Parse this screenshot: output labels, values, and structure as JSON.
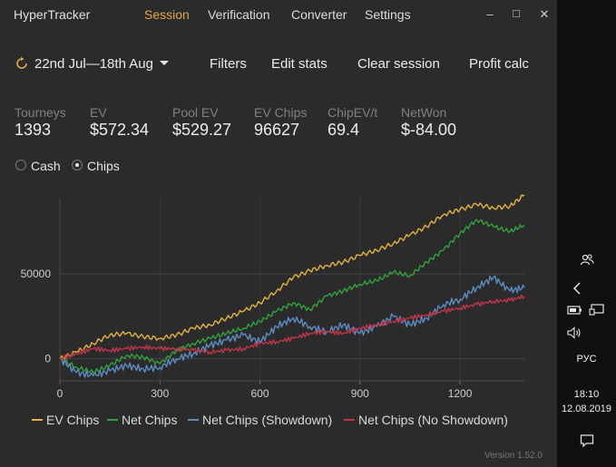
{
  "app": {
    "title": "HyperTracker",
    "nav": [
      "Session",
      "Verification",
      "Converter",
      "Settings"
    ],
    "active_nav": "Session"
  },
  "toolbar": {
    "date_range": "22nd Jul—18th Aug",
    "filters": "Filters",
    "edit_stats": "Edit stats",
    "clear_session": "Clear session",
    "profit_calc": "Profit calc"
  },
  "stats": [
    {
      "label": "Tourneys",
      "value": "1393"
    },
    {
      "label": "EV",
      "value": "$572.34"
    },
    {
      "label": "Pool EV",
      "value": "$529.27"
    },
    {
      "label": "EV Chips",
      "value": "96627"
    },
    {
      "label": "ChipEV/t",
      "value": "69.4"
    },
    {
      "label": "NetWon",
      "value": "$-84.00"
    }
  ],
  "mode": {
    "cash_label": "Cash",
    "chips_label": "Chips",
    "selected": "Chips"
  },
  "chart_data": {
    "type": "line",
    "x_ticks": [
      "0",
      "300",
      "600",
      "900",
      "1200"
    ],
    "y_ticks": [
      "0",
      "50000"
    ],
    "xlim": [
      0,
      1393
    ],
    "ylim": [
      -13000,
      95000
    ],
    "grid": true,
    "legend_position": "bottom",
    "series": [
      {
        "name": "EV Chips",
        "color": "#e3b23c",
        "x": [
          0,
          50,
          100,
          150,
          200,
          250,
          300,
          350,
          400,
          450,
          500,
          550,
          600,
          650,
          700,
          750,
          800,
          850,
          900,
          950,
          1000,
          1050,
          1100,
          1150,
          1200,
          1250,
          1300,
          1350,
          1393
        ],
        "y": [
          0,
          4000,
          9000,
          14000,
          15000,
          13000,
          12000,
          14000,
          18000,
          20000,
          24000,
          28000,
          33000,
          40000,
          48000,
          52000,
          55000,
          57000,
          61000,
          64000,
          68000,
          73000,
          78000,
          85000,
          88000,
          91000,
          89000,
          90000,
          96627
        ]
      },
      {
        "name": "Net Chips",
        "color": "#2fa33c",
        "x": [
          0,
          50,
          100,
          150,
          200,
          250,
          300,
          350,
          400,
          450,
          500,
          550,
          600,
          650,
          700,
          750,
          800,
          850,
          900,
          950,
          1000,
          1050,
          1100,
          1150,
          1200,
          1250,
          1300,
          1350,
          1393
        ],
        "y": [
          0,
          -5000,
          -8000,
          -4000,
          2000,
          1000,
          -3000,
          5000,
          9000,
          12000,
          15000,
          18000,
          22000,
          28000,
          33000,
          29000,
          37000,
          40000,
          44000,
          46000,
          51000,
          49000,
          57000,
          64000,
          74000,
          82000,
          78000,
          75000,
          79000
        ]
      },
      {
        "name": "Net Chips (Showdown)",
        "color": "#5b8cc2",
        "x": [
          0,
          50,
          100,
          150,
          200,
          250,
          300,
          350,
          400,
          450,
          500,
          550,
          600,
          650,
          700,
          750,
          800,
          850,
          900,
          950,
          1000,
          1050,
          1100,
          1150,
          1200,
          1250,
          1300,
          1350,
          1393
        ],
        "y": [
          0,
          -8000,
          -10000,
          -7000,
          -4000,
          -6000,
          -5000,
          0,
          3000,
          8000,
          11000,
          14000,
          10000,
          19000,
          24000,
          19000,
          16000,
          20000,
          15000,
          19000,
          25000,
          20000,
          24000,
          32000,
          35000,
          42000,
          48000,
          40000,
          42000
        ]
      },
      {
        "name": "Net Chips (No Showdown)",
        "color": "#c0354a",
        "x": [
          0,
          50,
          100,
          150,
          200,
          250,
          300,
          350,
          400,
          450,
          500,
          550,
          600,
          650,
          700,
          750,
          800,
          850,
          900,
          950,
          1000,
          1050,
          1100,
          1150,
          1200,
          1250,
          1300,
          1350,
          1393
        ],
        "y": [
          0,
          3000,
          6000,
          5000,
          6000,
          7000,
          6000,
          6000,
          5000,
          4000,
          5000,
          6000,
          9000,
          10000,
          12000,
          15000,
          16000,
          15000,
          18000,
          20000,
          22000,
          24000,
          26000,
          28000,
          30000,
          32000,
          34000,
          34500,
          37000
        ]
      }
    ]
  },
  "version": "Version 1.52.0",
  "taskbar": {
    "language": "РУС",
    "time": "18:10",
    "date": "12.08.2019"
  }
}
